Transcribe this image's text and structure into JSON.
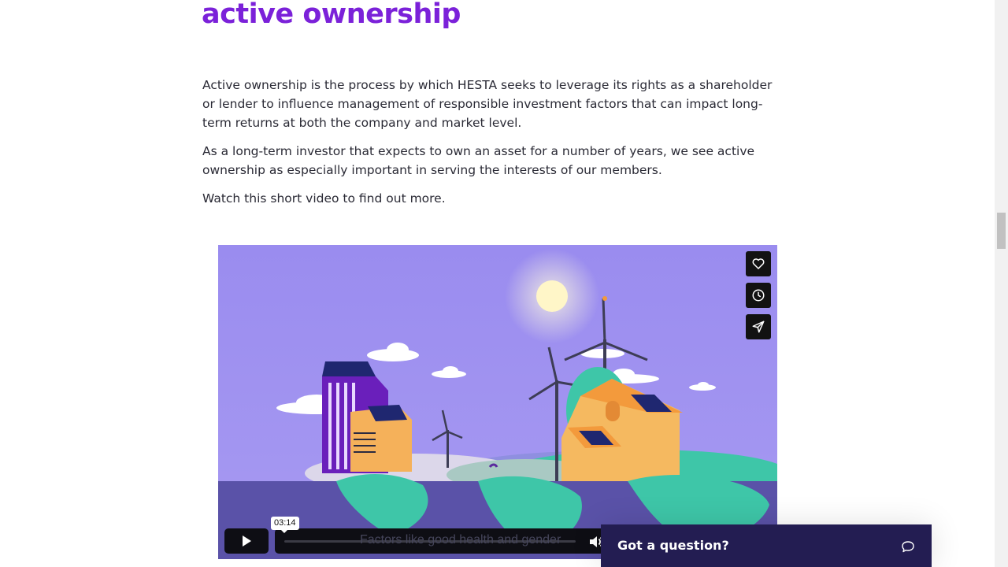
{
  "page": {
    "heading": "active ownership",
    "paragraphs": [
      "Active ownership is the process by which HESTA seeks to leverage its rights as a shareholder or lender to influence management of responsible investment factors that can impact long-term returns at both the company and market level.",
      "As a long-term investor that expects to own an asset for a number of years, we see active ownership as especially important in serving the interests of our members.",
      "Watch this short video to find out more."
    ]
  },
  "video": {
    "time_tooltip": "03:14",
    "caption": "Factors like good health and gender",
    "progress": 0,
    "side_buttons": [
      "heart-icon",
      "clock-icon",
      "send-icon"
    ],
    "controls_icons": [
      "play-icon",
      "volume-icon"
    ]
  },
  "chat": {
    "label": "Got a question?",
    "icon": "chat-bubble-icon"
  },
  "colors": {
    "heading": "#7b21d9",
    "chat_bg": "#231d52",
    "video_sky": "#9b8ef0"
  }
}
